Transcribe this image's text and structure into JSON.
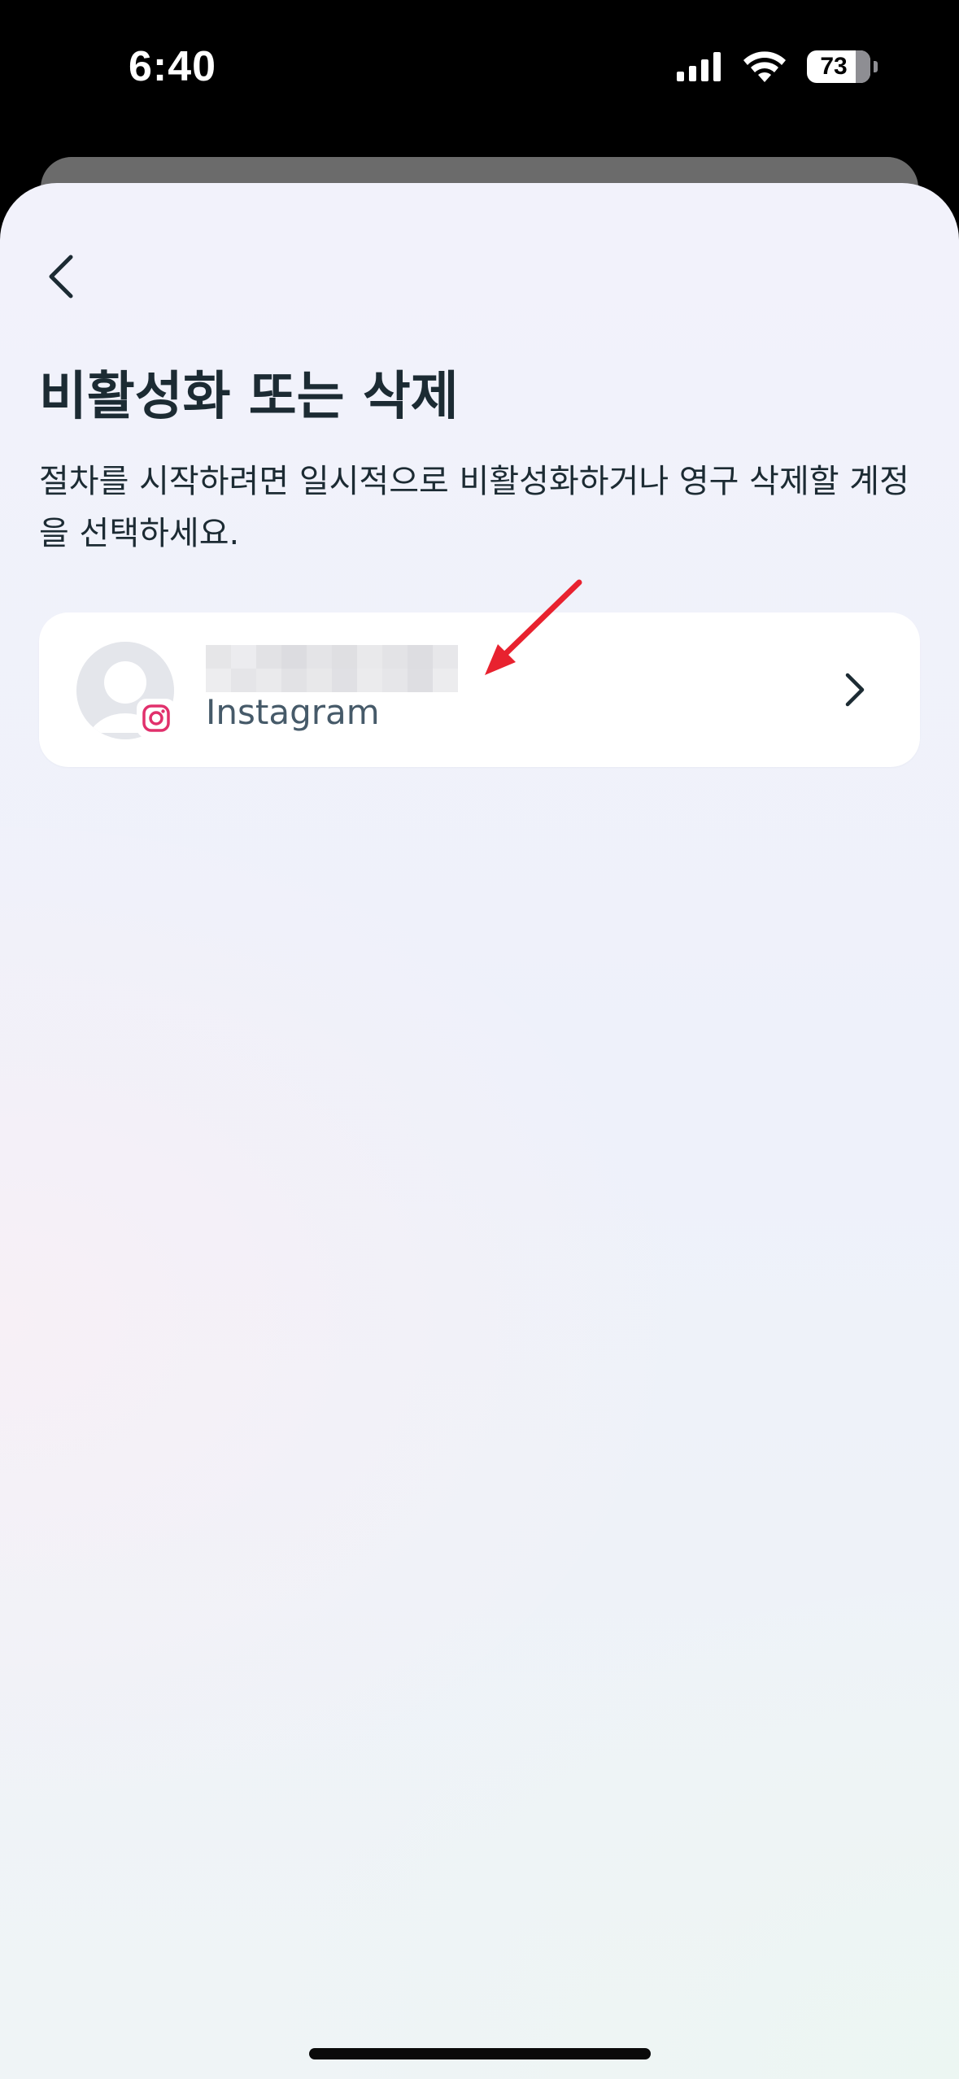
{
  "status_bar": {
    "time": "6:40",
    "battery": "73"
  },
  "page": {
    "title": "비활성화 또는 삭제",
    "subtitle": "절차를 시작하려면 일시적으로 비활성화하거나 영구 삭제할 계정을 선택하세요."
  },
  "account": {
    "platform": "Instagram",
    "username_redacted": true
  },
  "icons": {
    "back": "chevron-left-icon",
    "open": "chevron-right-icon",
    "badge": "instagram-icon"
  },
  "colors": {
    "annotation_arrow": "#e8222f",
    "text": "#1c2b33"
  }
}
